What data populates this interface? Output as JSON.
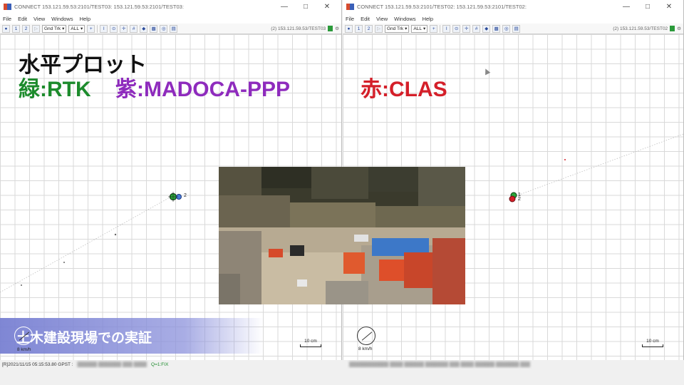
{
  "left_window": {
    "title": "CONNECT 153.121.59.53:2101/TEST03: 153.121.59.53:2101/TEST03:",
    "menu": [
      "File",
      "Edit",
      "View",
      "Windows",
      "Help"
    ],
    "toolbar": {
      "btn_a": "1",
      "btn_b": "2",
      "plot_type": "Gnd Trk",
      "sat": "ALL",
      "stream": "(2) 153.121.59.53/TEST03"
    },
    "heading": {
      "line1": "水平プロット",
      "rtk": "緑:RTK",
      "madoca": "紫:MADOCA-PPP"
    },
    "marker_label": "2",
    "scale_label": "10 cm",
    "speed_label": "8 km/h",
    "status": {
      "time": "[R]2021/11/15 05:15:53.80 GPST :",
      "quality": "Q=1:FIX"
    }
  },
  "right_window": {
    "title": "CONNECT 153.121.59.53:2101/TEST02: 153.121.59.53:2101/TEST02:",
    "menu": [
      "File",
      "Edit",
      "View",
      "Windows",
      "Help"
    ],
    "toolbar": {
      "btn_a": "1",
      "btn_b": "2",
      "plot_type": "Gnd Trk",
      "sat": "ALL",
      "stream": "(2) 153.121.59.53/TEST02"
    },
    "heading": {
      "clas": "赤:CLAS"
    },
    "marker_label_1": "1",
    "marker_label_2": "2",
    "scale_label": "10 cm",
    "speed_label": "8 km/h"
  },
  "banner": {
    "text": "土木建設現場での実証"
  },
  "colors": {
    "rtk": "#1c8b2c",
    "madoca": "#8e2bbd",
    "clas": "#d41f29",
    "banner": "#7880d2"
  },
  "icons": [
    "app-icon",
    "minimize-icon",
    "maximize-icon",
    "close-icon",
    "compass-icon",
    "settings-icon"
  ]
}
